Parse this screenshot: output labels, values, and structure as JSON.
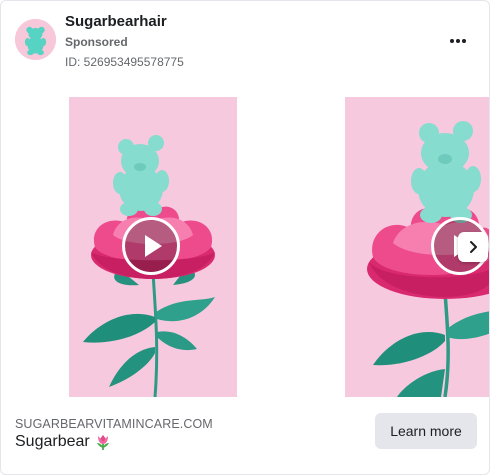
{
  "advertiser": {
    "name": "Sugarbearhair",
    "sponsored_label": "Sponsored",
    "ad_id": "ID: 526953495578775"
  },
  "icons": {
    "avatar": "gummy-bear-logo-icon",
    "more": "more-options-icon",
    "play": "play-icon",
    "next": "chevron-right-icon",
    "tulip": "tulip-emoji-icon"
  },
  "carousel": {
    "slides": [
      {
        "media": "video",
        "subject": "teal gummy bear on pink peony"
      },
      {
        "media": "video",
        "subject": "teal gummy bear on pink peony"
      }
    ]
  },
  "footer": {
    "domain": "SUGARBEARVITAMINCARE.COM",
    "title": "Sugarbear",
    "title_emoji": "🌷",
    "cta_label": "Learn more"
  },
  "colors": {
    "background_pink": "#f7c9de",
    "bear_teal": "#7fd8cc",
    "flower_pink": "#e8387f",
    "stem_green": "#2e9a86",
    "cta_gray": "#e4e6eb",
    "secondary_text": "#65676b"
  }
}
